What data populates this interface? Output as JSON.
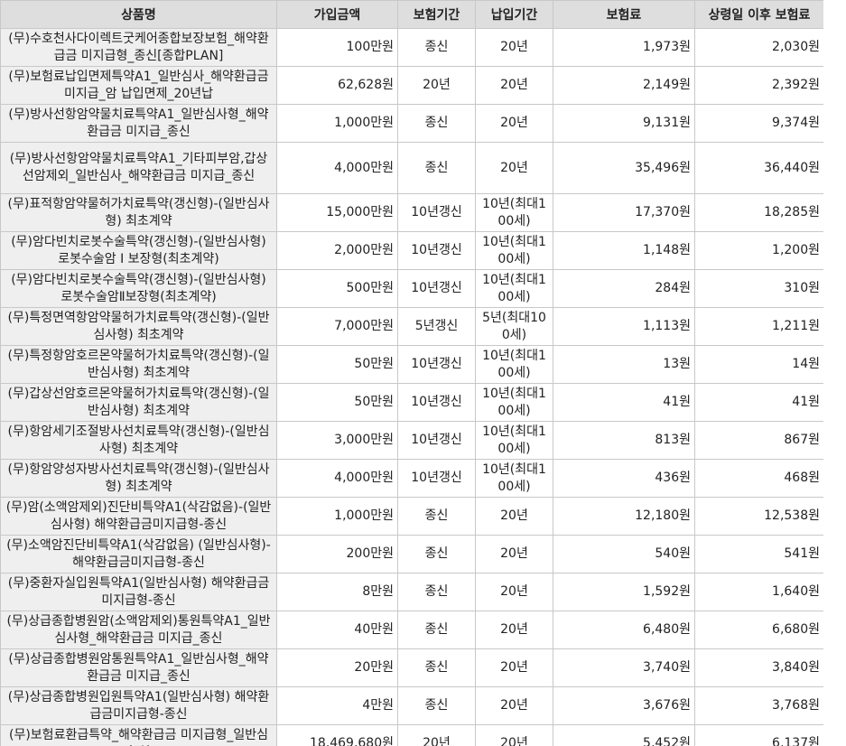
{
  "headers": {
    "name": "상품명",
    "amount": "가입금액",
    "period": "보험기간",
    "pay": "납입기간",
    "premium": "보험료",
    "after": "상령일 이후 보험료"
  },
  "rows": [
    {
      "name": "(무)수호천사다이렉트굿케어종합보장보험_해약환급금 미지급형_종신[종합PLAN]",
      "amount": "100만원",
      "period": "종신",
      "pay": "20년",
      "premium": "1,973원",
      "after": "2,030원"
    },
    {
      "name": "(무)보험료납입면제특약A1_일반심사_해약환급금 미지급_암 납입면제_20년납",
      "amount": "62,628원",
      "period": "20년",
      "pay": "20년",
      "premium": "2,149원",
      "after": "2,392원"
    },
    {
      "name": "(무)방사선항암약물치료특약A1_일반심사형_해약환급금 미지급_종신",
      "amount": "1,000만원",
      "period": "종신",
      "pay": "20년",
      "premium": "9,131원",
      "after": "9,374원"
    },
    {
      "name": "(무)방사선항암약물치료특약A1_기타피부암,갑상선암제외_일반심사_해약환급금 미지급_종신",
      "amount": "4,000만원",
      "period": "종신",
      "pay": "20년",
      "premium": "35,496원",
      "after": "36,440원"
    },
    {
      "name": "(무)표적항암약물허가치료특약(갱신형)-(일반심사형) 최초계약",
      "amount": "15,000만원",
      "period": "10년갱신",
      "pay": "10년(최대100세)",
      "premium": "17,370원",
      "after": "18,285원"
    },
    {
      "name": "(무)암다빈치로봇수술특약(갱신형)-(일반심사형) 로봇수술암 I 보장형(최초계약)",
      "amount": "2,000만원",
      "period": "10년갱신",
      "pay": "10년(최대100세)",
      "premium": "1,148원",
      "after": "1,200원"
    },
    {
      "name": "(무)암다빈치로봇수술특약(갱신형)-(일반심사형) 로봇수술암Ⅱ보장형(최초계약)",
      "amount": "500만원",
      "period": "10년갱신",
      "pay": "10년(최대100세)",
      "premium": "284원",
      "after": "310원"
    },
    {
      "name": "(무)특정면역항암약물허가치료특약(갱신형)-(일반심사형) 최초계약",
      "amount": "7,000만원",
      "period": "5년갱신",
      "pay": "5년(최대100세)",
      "premium": "1,113원",
      "after": "1,211원"
    },
    {
      "name": "(무)특정항암호르몬약물허가치료특약(갱신형)-(일반심사형) 최초계약",
      "amount": "50만원",
      "period": "10년갱신",
      "pay": "10년(최대100세)",
      "premium": "13원",
      "after": "14원"
    },
    {
      "name": "(무)갑상선암호르몬약물허가치료특약(갱신형)-(일반심사형) 최초계약",
      "amount": "50만원",
      "period": "10년갱신",
      "pay": "10년(최대100세)",
      "premium": "41원",
      "after": "41원"
    },
    {
      "name": "(무)항암세기조절방사선치료특약(갱신형)-(일반심사형) 최초계약",
      "amount": "3,000만원",
      "period": "10년갱신",
      "pay": "10년(최대100세)",
      "premium": "813원",
      "after": "867원"
    },
    {
      "name": "(무)항암양성자방사선치료특약(갱신형)-(일반심사형) 최초계약",
      "amount": "4,000만원",
      "period": "10년갱신",
      "pay": "10년(최대100세)",
      "premium": "436원",
      "after": "468원"
    },
    {
      "name": "(무)암(소액암제외)진단비특약A1(삭감없음)-(일반심사형) 해약환급금미지급형-종신",
      "amount": "1,000만원",
      "period": "종신",
      "pay": "20년",
      "premium": "12,180원",
      "after": "12,538원"
    },
    {
      "name": "(무)소액암진단비특약A1(삭감없음) (일반심사형)-해약환급금미지급형-종신",
      "amount": "200만원",
      "period": "종신",
      "pay": "20년",
      "premium": "540원",
      "after": "541원"
    },
    {
      "name": "(무)중환자실입원특약A1(일반심사형) 해약환급금미지급형-종신",
      "amount": "8만원",
      "period": "종신",
      "pay": "20년",
      "premium": "1,592원",
      "after": "1,640원"
    },
    {
      "name": "(무)상급종합병원암(소액암제외)통원특약A1_일반심사형_해약환급금 미지급_종신",
      "amount": "40만원",
      "period": "종신",
      "pay": "20년",
      "premium": "6,480원",
      "after": "6,680원"
    },
    {
      "name": "(무)상급종합병원암통원특약A1_일반심사형_해약환급금 미지급_종신",
      "amount": "20만원",
      "period": "종신",
      "pay": "20년",
      "premium": "3,740원",
      "after": "3,840원"
    },
    {
      "name": "(무)상급종합병원입원특약A1(일반심사형) 해약환급금미지급형-종신",
      "amount": "4만원",
      "period": "종신",
      "pay": "20년",
      "premium": "3,676원",
      "after": "3,768원"
    },
    {
      "name": "(무)보험료환급특약_해약환급금 미지급형_일반심사(처)",
      "amount": "18,469,680원",
      "period": "20년",
      "pay": "20년",
      "premium": "5,452원",
      "after": "6,137원"
    }
  ]
}
